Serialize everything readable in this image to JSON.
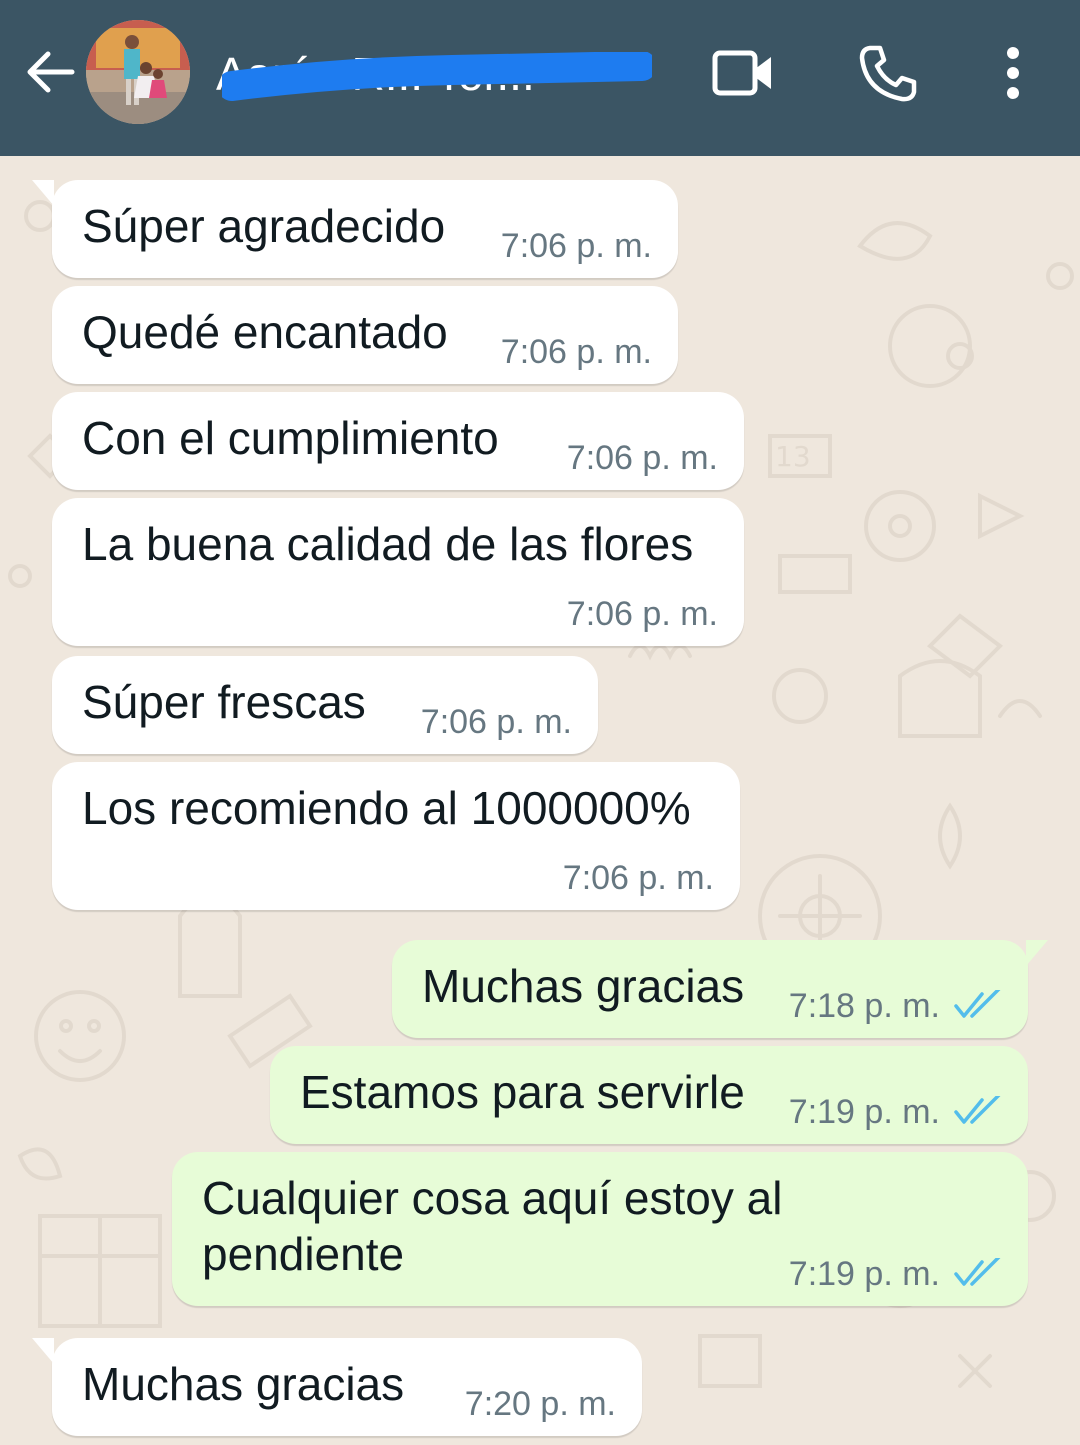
{
  "header": {
    "contact_name": "Aarón R... Tor...",
    "avatar_icon": "contact-avatar-photo",
    "back_icon": "arrow-left-icon",
    "video_icon": "video-camera-icon",
    "call_icon": "phone-icon",
    "menu_icon": "more-vertical-icon",
    "background": "#3b5564"
  },
  "colors": {
    "incoming_bubble": "#ffffff",
    "outgoing_bubble": "#e7fcd7",
    "read_ticks": "#53bdeb",
    "time_text": "#667781",
    "chat_background": "#efe7dd"
  },
  "messages": [
    {
      "direction": "in",
      "text": "Súper agradecido",
      "time": "7:06 p. m."
    },
    {
      "direction": "in",
      "text": "Quedé encantado",
      "time": "7:06 p. m."
    },
    {
      "direction": "in",
      "text": "Con el cumplimiento",
      "time": "7:06 p. m."
    },
    {
      "direction": "in",
      "text": "La buena calidad de las flores",
      "time": "7:06 p. m."
    },
    {
      "direction": "in",
      "text": "Súper frescas",
      "time": "7:06 p. m."
    },
    {
      "direction": "in",
      "text": "Los recomiendo al 1000000%",
      "time": "7:06 p. m."
    },
    {
      "direction": "out",
      "text": "Muchas gracias",
      "time": "7:18 p. m.",
      "status": "read"
    },
    {
      "direction": "out",
      "text": "Estamos para servirle",
      "time": "7:19 p. m.",
      "status": "read"
    },
    {
      "direction": "out",
      "text_line1": "Cualquier cosa aquí estoy al",
      "text_line2": "pendiente",
      "time": "7:19 p. m.",
      "status": "read"
    },
    {
      "direction": "in",
      "text": "Muchas gracias",
      "time": "7:20 p. m."
    }
  ]
}
